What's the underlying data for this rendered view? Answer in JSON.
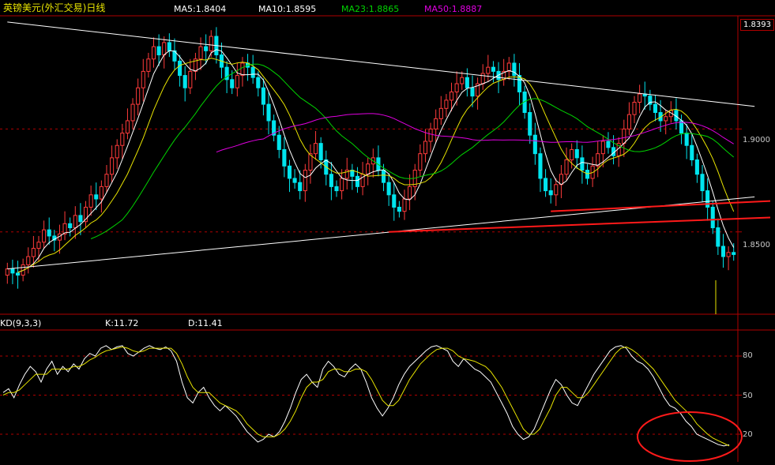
{
  "header": {
    "instrument": "英镑美元(外汇交易)日线",
    "ma5": "MA5:1.8404",
    "ma10": "MA10:1.8595",
    "ma23": "MA23:1.8865",
    "ma50": "MA50:1.8887",
    "last_price": "1.8393"
  },
  "kd_header": {
    "name": "KD(9,3,3)",
    "k": "K:11.72",
    "d": "D:11.41"
  },
  "colors": {
    "up": "#ff3b3b",
    "down": "#00e5ee",
    "ma5": "#ffffff",
    "ma10": "#e8e400",
    "ma23": "#00d400",
    "ma50": "#e000e0",
    "grid": "#b00000",
    "trend": "#ffffff",
    "support": "#ff1a1a",
    "circle": "#ff1a1a"
  },
  "chart_data": [
    {
      "type": "candlestick",
      "title": "英镑美元(外汇交易)日线",
      "ylim": [
        1.81,
        1.955
      ],
      "yticks": [
        "1.9000",
        "1.8500"
      ],
      "ytick_values": [
        1.9,
        1.85
      ],
      "grid": true,
      "series_legend": [
        {
          "name": "MA5",
          "value": 1.8404,
          "color": "#ffffff"
        },
        {
          "name": "MA10",
          "value": 1.8595,
          "color": "#e8e400"
        },
        {
          "name": "MA23",
          "value": 1.8865,
          "color": "#00d400"
        },
        {
          "name": "MA50",
          "value": 1.8887,
          "color": "#e000e0"
        }
      ],
      "last_close": 1.8393,
      "close": [
        1.832,
        1.83,
        1.829,
        1.834,
        1.838,
        1.842,
        1.845,
        1.851,
        1.848,
        1.846,
        1.849,
        1.854,
        1.852,
        1.858,
        1.855,
        1.862,
        1.868,
        1.866,
        1.872,
        1.878,
        1.886,
        1.892,
        1.898,
        1.904,
        1.912,
        1.92,
        1.928,
        1.934,
        1.94,
        1.936,
        1.942,
        1.938,
        1.933,
        1.926,
        1.92,
        1.928,
        1.934,
        1.94,
        1.938,
        1.945,
        1.936,
        1.93,
        1.924,
        1.92,
        1.926,
        1.932,
        1.93,
        1.925,
        1.92,
        1.912,
        1.904,
        1.897,
        1.89,
        1.882,
        1.876,
        1.874,
        1.87,
        1.88,
        1.888,
        1.893,
        1.885,
        1.878,
        1.872,
        1.87,
        1.876,
        1.88,
        1.877,
        1.872,
        1.878,
        1.883,
        1.886,
        1.88,
        1.874,
        1.868,
        1.862,
        1.86,
        1.866,
        1.872,
        1.88,
        1.888,
        1.894,
        1.9,
        1.905,
        1.91,
        1.914,
        1.918,
        1.922,
        1.925,
        1.92,
        1.916,
        1.922,
        1.927,
        1.93,
        1.928,
        1.924,
        1.928,
        1.932,
        1.926,
        1.918,
        1.908,
        1.897,
        1.888,
        1.876,
        1.87,
        1.868,
        1.873,
        1.878,
        1.885,
        1.89,
        1.886,
        1.88,
        1.876,
        1.882,
        1.888,
        1.894,
        1.891,
        1.887,
        1.893,
        1.9,
        1.907,
        1.913,
        1.917,
        1.916,
        1.912,
        1.908,
        1.904,
        1.906,
        1.909,
        1.904,
        1.898,
        1.892,
        1.885,
        1.878,
        1.87,
        1.862,
        1.852,
        1.843,
        1.838,
        1.84,
        1.839
      ],
      "lines": {
        "upper_trend": {
          "from": [
            0,
            1.952
          ],
          "to": [
            143,
            1.911
          ],
          "color": "#ffffff"
        },
        "lower_trend": {
          "from": [
            0,
            1.832
          ],
          "to": [
            143,
            1.867
          ],
          "color": "#ffffff"
        },
        "support_1": {
          "from": [
            104,
            1.86
          ],
          "to": [
            150,
            1.865
          ],
          "color": "#ff1a1a"
        },
        "support_2": {
          "from": [
            73,
            1.85
          ],
          "to": [
            150,
            1.857
          ],
          "color": "#ff1a1a"
        }
      }
    },
    {
      "type": "line",
      "title": "KD(9,3,3)",
      "ylim": [
        0,
        100
      ],
      "yticks": [
        "80",
        "50",
        "20"
      ],
      "ytick_values": [
        80,
        50,
        20
      ],
      "grid": true,
      "series": [
        {
          "name": "K",
          "color": "#ffffff",
          "last": 11.72,
          "values": [
            52,
            55,
            48,
            58,
            66,
            72,
            68,
            60,
            70,
            76,
            66,
            72,
            68,
            74,
            70,
            78,
            82,
            80,
            86,
            88,
            85,
            87,
            88,
            82,
            80,
            83,
            86,
            88,
            86,
            85,
            87,
            84,
            76,
            60,
            48,
            44,
            52,
            56,
            48,
            42,
            38,
            42,
            38,
            34,
            28,
            22,
            18,
            14,
            16,
            20,
            18,
            22,
            30,
            40,
            52,
            62,
            66,
            60,
            56,
            70,
            76,
            72,
            66,
            64,
            70,
            74,
            70,
            60,
            48,
            40,
            34,
            40,
            48,
            58,
            66,
            72,
            76,
            80,
            84,
            87,
            88,
            86,
            84,
            76,
            72,
            78,
            74,
            70,
            68,
            64,
            60,
            52,
            44,
            36,
            26,
            20,
            16,
            18,
            24,
            34,
            44,
            54,
            62,
            58,
            50,
            44,
            42,
            50,
            58,
            66,
            72,
            78,
            84,
            87,
            88,
            86,
            80,
            76,
            74,
            70,
            64,
            56,
            48,
            42,
            40,
            36,
            30,
            26,
            20,
            18,
            16,
            14,
            12,
            11,
            12
          ]
        },
        {
          "name": "D",
          "color": "#e8e400",
          "last": 11.41,
          "values": [
            50,
            52,
            52,
            54,
            58,
            62,
            66,
            66,
            66,
            70,
            70,
            70,
            70,
            72,
            72,
            74,
            77,
            79,
            82,
            84,
            85,
            86,
            87,
            86,
            84,
            83,
            84,
            86,
            86,
            86,
            86,
            86,
            82,
            74,
            64,
            56,
            52,
            52,
            52,
            48,
            44,
            42,
            40,
            38,
            34,
            28,
            24,
            20,
            18,
            18,
            18,
            20,
            24,
            30,
            38,
            48,
            56,
            60,
            60,
            62,
            68,
            70,
            70,
            68,
            68,
            70,
            70,
            68,
            62,
            54,
            46,
            42,
            42,
            46,
            54,
            62,
            68,
            74,
            78,
            82,
            85,
            86,
            86,
            84,
            80,
            78,
            77,
            76,
            74,
            72,
            68,
            62,
            56,
            48,
            40,
            32,
            24,
            20,
            20,
            24,
            32,
            40,
            50,
            56,
            56,
            52,
            48,
            48,
            52,
            58,
            64,
            70,
            76,
            82,
            86,
            87,
            85,
            82,
            78,
            74,
            70,
            64,
            58,
            52,
            46,
            42,
            38,
            34,
            28,
            24,
            20,
            17,
            15,
            13,
            11
          ]
        }
      ]
    }
  ]
}
